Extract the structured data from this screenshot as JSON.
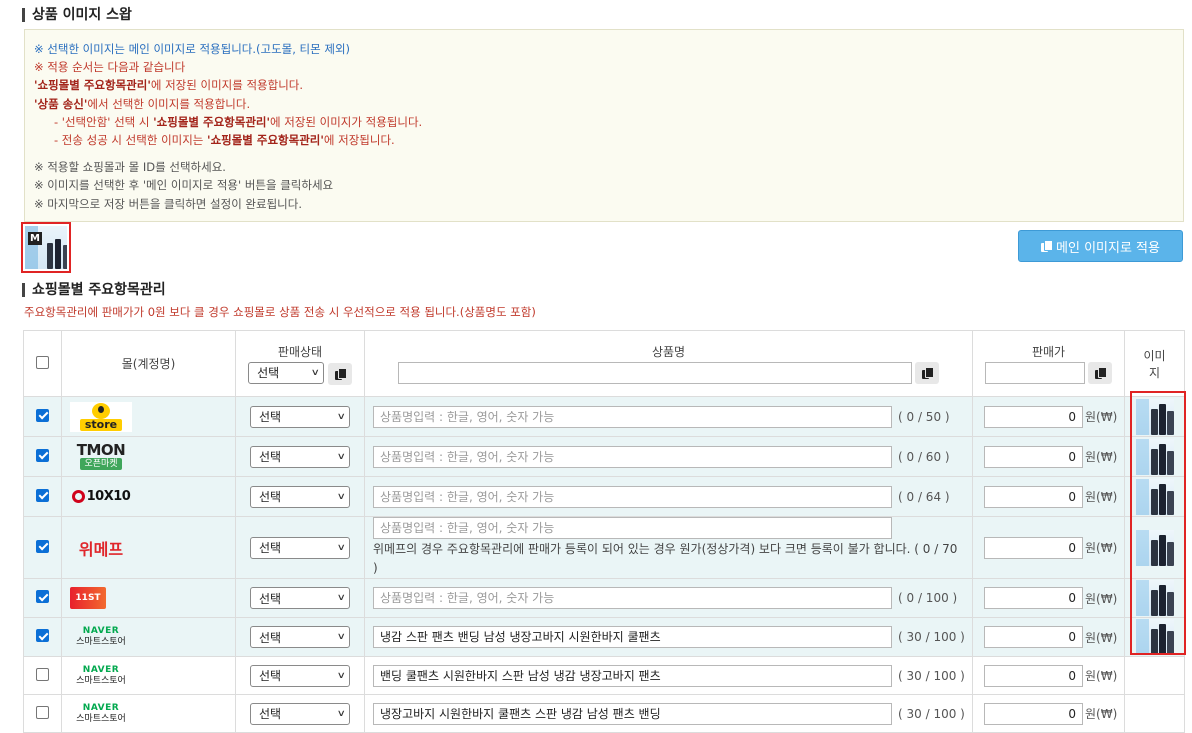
{
  "section1_title": "상품 이미지 스왑",
  "notice": {
    "line1": "※ 선택한 이미지는 메인 이미지로 적용됩니다.(고도몰, 티몬 제외)",
    "line2": "※ 적용 순서는 다음과 같습니다",
    "line3_bold": "'쇼핑몰별 주요항목관리'",
    "line3_rest": "에 저장된 이미지를 적용합니다.",
    "line4_bold": "'상품 송신'",
    "line4_rest": "에서 선택한 이미지를 적용합니다.",
    "line5_pre": "- '선택안함' 선택 시 ",
    "line5_bold": "'쇼핑몰별 주요항목관리'",
    "line5_rest": "에 저장된 이미지가 적용됩니다.",
    "line6_pre": "- 전송 성공 시 선택한 이미지는 ",
    "line6_bold": "'쇼핑몰별 주요항목관리'",
    "line6_rest": "에 저장됩니다.",
    "line7": "※ 적용할 쇼핑몰과 몰 ID를 선택하세요.",
    "line8": "※ 이미지를 선택한 후 '메인 이미지로 적용' 버튼을 클릭하세요",
    "line9": "※ 마지막으로 저장 버튼을 클릭하면 설정이 완료됩니다."
  },
  "thumb_badge": "M",
  "apply_button": "메인 이미지로 적용",
  "section2_title": "쇼핑몰별 주요항목관리",
  "subnote": "주요항목관리에 판매가가 0원 보다 클 경우 쇼핑몰로 상품 전송 시 우선적으로 적용 됩니다.(상품명도 포함)",
  "headers": {
    "mall": "몰(계정명)",
    "status": "판매상태",
    "status_select": "선택",
    "name": "상품명",
    "price": "판매가",
    "image_line1": "이미",
    "image_line2": "지"
  },
  "placeholder": "상품명입력 : 한글, 영어, 숫자 가능",
  "won": "원(₩)",
  "rows": [
    {
      "logo": "kakao-store",
      "logo_text": "store",
      "status": "선택",
      "name": "",
      "count": "( 0 / 50 )",
      "price": "0"
    },
    {
      "logo": "tmon",
      "logo_text": "TMON",
      "logo_sub": "오픈마켓",
      "status": "선택",
      "name": "",
      "count": "( 0 / 60 )",
      "price": "0"
    },
    {
      "logo": "10x10",
      "logo_text": "10X10",
      "status": "선택",
      "name": "",
      "count": "( 0 / 64 )",
      "price": "0"
    },
    {
      "logo": "wemakeprice",
      "logo_text": "위메프",
      "status": "선택",
      "name": "",
      "warning": "위메프의 경우 주요항목관리에 판매가 등록이 되어 있는 경우 원가(정상가격) 보다 크면 등록이 불가 합니다. ( 0 / 70 )",
      "price": "0"
    },
    {
      "logo": "11st",
      "logo_text": "11ST",
      "status": "선택",
      "name": "",
      "count": "( 0 / 100 )",
      "price": "0"
    },
    {
      "logo": "naver",
      "logo_text": "NAVER",
      "logo_sub": "스마트스토어",
      "status": "선택",
      "name": "냉감 스판 팬츠 밴딩 남성 냉장고바지 시원한바지 쿨팬츠",
      "count": "( 30 / 100 )",
      "price": "0"
    },
    {
      "logo": "naver",
      "logo_text": "NAVER",
      "logo_sub": "스마트스토어",
      "status": "선택",
      "name": "밴딩 쿨팬츠 시원한바지 스판 남성 냉감 냉장고바지 팬츠",
      "count": "( 30 / 100 )",
      "price": "0"
    },
    {
      "logo": "naver",
      "logo_text": "NAVER",
      "logo_sub": "스마트스토어",
      "status": "선택",
      "name": "냉장고바지 시원한바지 쿨팬츠 스판 냉감 남성 팬츠 밴딩",
      "count": "( 30 / 100 )",
      "price": "0"
    }
  ],
  "checked": [
    true,
    true,
    true,
    true,
    true,
    true,
    false,
    false
  ],
  "colors": {
    "accent_blue": "#5bb4ea",
    "checkbox_blue": "#0b6fd6",
    "warning_red": "#c0392b",
    "highlight_border": "#e02424",
    "row_selected_bg": "#eaf5f6"
  }
}
